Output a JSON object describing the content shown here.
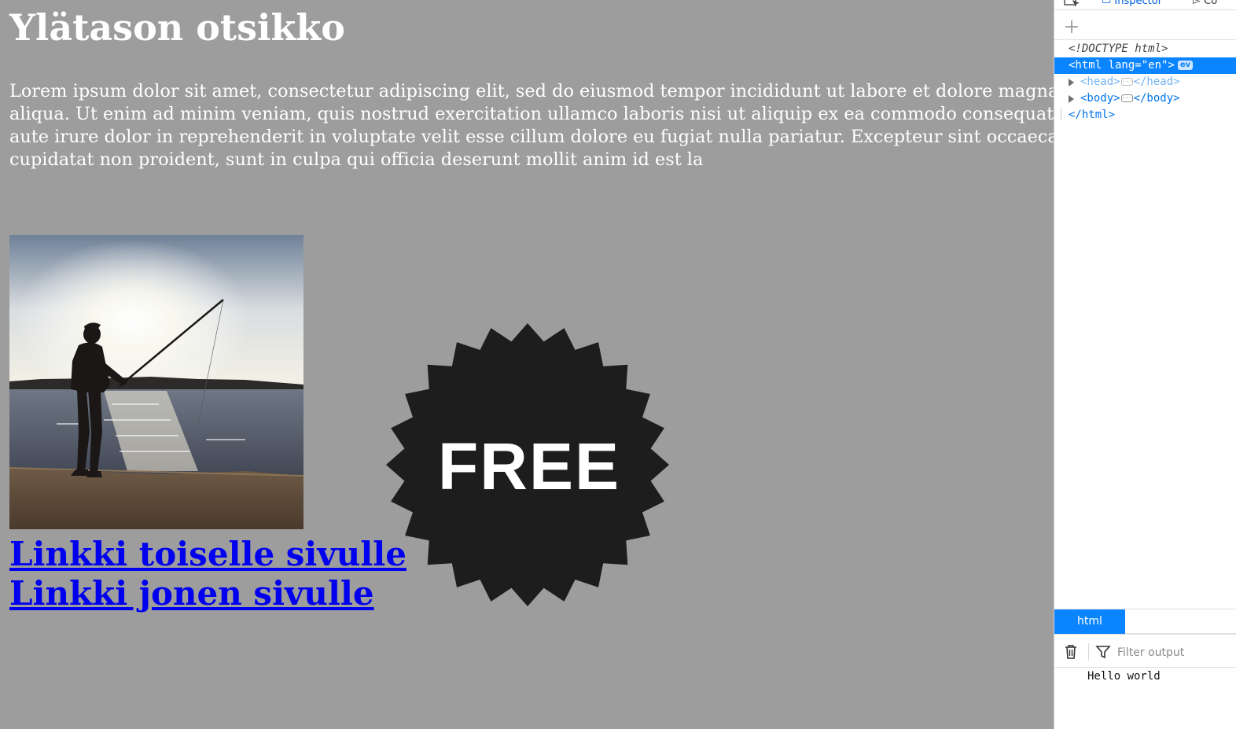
{
  "page": {
    "heading": "Ylätason otsikko",
    "paragraph": "Lorem ipsum dolor sit amet, consectetur adipiscing elit, sed do eiusmod tempor incididunt ut labore et dolore magna aliqua. Ut enim ad minim veniam, quis nostrud exercitation ullamco laboris nisi ut aliquip ex ea commodo consequat. Duis aute irure dolor in reprehenderit in voluptate velit esse cillum dolore eu fugiat nulla pariatur. Excepteur sint occaecat cupidatat non proident, sunt in culpa qui officia deserunt mollit anim id est la",
    "links": [
      "Linkki toiselle sivulle",
      "Linkki jonen sivulle"
    ],
    "badge_text": "FREE",
    "colors": {
      "background": "#9d9d9d",
      "link": "#0000ee",
      "badge": "#1e1d1e"
    }
  },
  "devtools": {
    "tabs": {
      "inspector": "Inspector",
      "console": "Co"
    },
    "tree": {
      "doctype": "<!DOCTYPE html>",
      "html_open": "<html lang=\"en\">",
      "ev_badge": "ev",
      "head_open": "<head>",
      "head_close": "</head>",
      "body_open": "<body>",
      "body_close": "</body>",
      "html_close": "</html>"
    },
    "breadcrumb": "html",
    "console": {
      "filter_placeholder": "Filter output",
      "messages": [
        "Hello world"
      ]
    },
    "accent": "#0a84ff"
  }
}
